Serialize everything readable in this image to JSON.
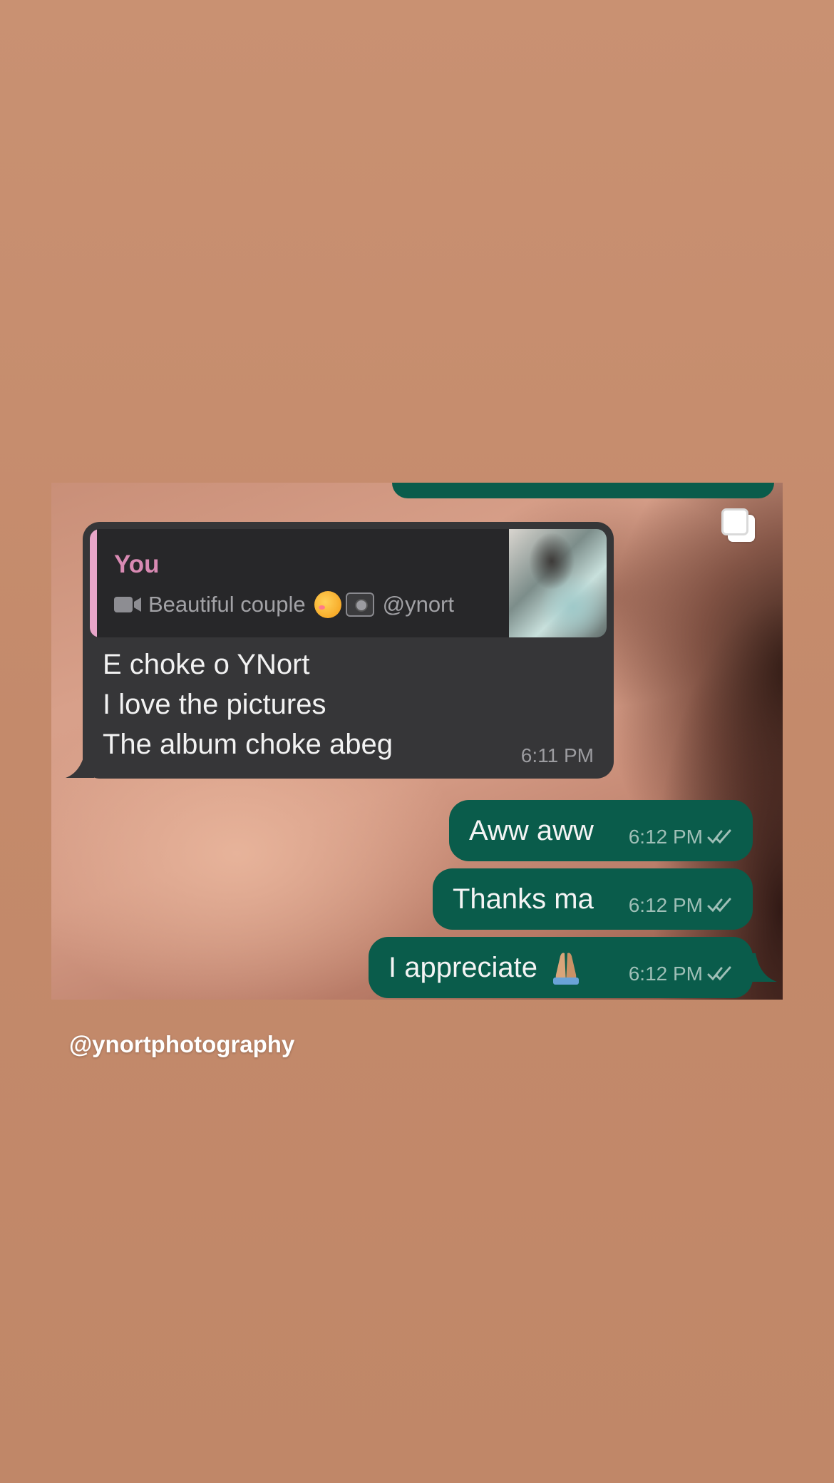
{
  "quoted_message": {
    "author": "You",
    "caption": "Beautiful couple",
    "mention": "@ynort"
  },
  "incoming_message": {
    "lines": [
      "E choke o YNort",
      "I love the pictures",
      "The album choke abeg"
    ],
    "time": "6:11 PM"
  },
  "outgoing_messages": [
    {
      "text": "Aww aww",
      "time": "6:12 PM"
    },
    {
      "text": "Thanks ma",
      "time": "6:12 PM"
    },
    {
      "text": "I appreciate",
      "time": "6:12 PM"
    }
  ],
  "story_handle": "@ynortphotography",
  "colors": {
    "outgoing_bubble": "#0a5c4b",
    "incoming_bubble": "#363638",
    "quote_accent": "#e8a6c9",
    "page_background": "#c48a6b"
  },
  "icons": [
    "video-camera-icon",
    "double-check-icon",
    "multiple-images-icon",
    "smiling-face-with-hearts-emoji",
    "camera-with-flash-emoji",
    "folded-hands-emoji"
  ]
}
